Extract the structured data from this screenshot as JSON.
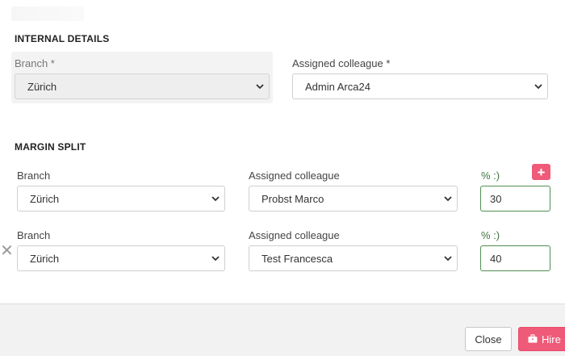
{
  "internal_details": {
    "title": "INTERNAL DETAILS",
    "branch_label": "Branch *",
    "branch_value": "Zürich",
    "colleague_label": "Assigned colleague *",
    "colleague_value": "Admin Arca24"
  },
  "margin_split": {
    "title": "MARGIN SPLIT",
    "rows": [
      {
        "branch_label": "Branch",
        "branch_value": "Zürich",
        "colleague_label": "Assigned colleague",
        "colleague_value": "Probst Marco",
        "percent_label": "% :)",
        "percent_value": "30"
      },
      {
        "branch_label": "Branch",
        "branch_value": "Zürich",
        "colleague_label": "Assigned colleague",
        "colleague_value": "Test Francesca",
        "percent_label": "% :)",
        "percent_value": "40"
      }
    ],
    "add_icon": "plus-icon",
    "remove_icon": "close-icon"
  },
  "footer": {
    "close_label": "Close",
    "hire_label": "Hire",
    "hire_icon": "briefcase-icon"
  },
  "colors": {
    "accent": "#ef5a78",
    "valid_border": "#4f8f4f"
  }
}
